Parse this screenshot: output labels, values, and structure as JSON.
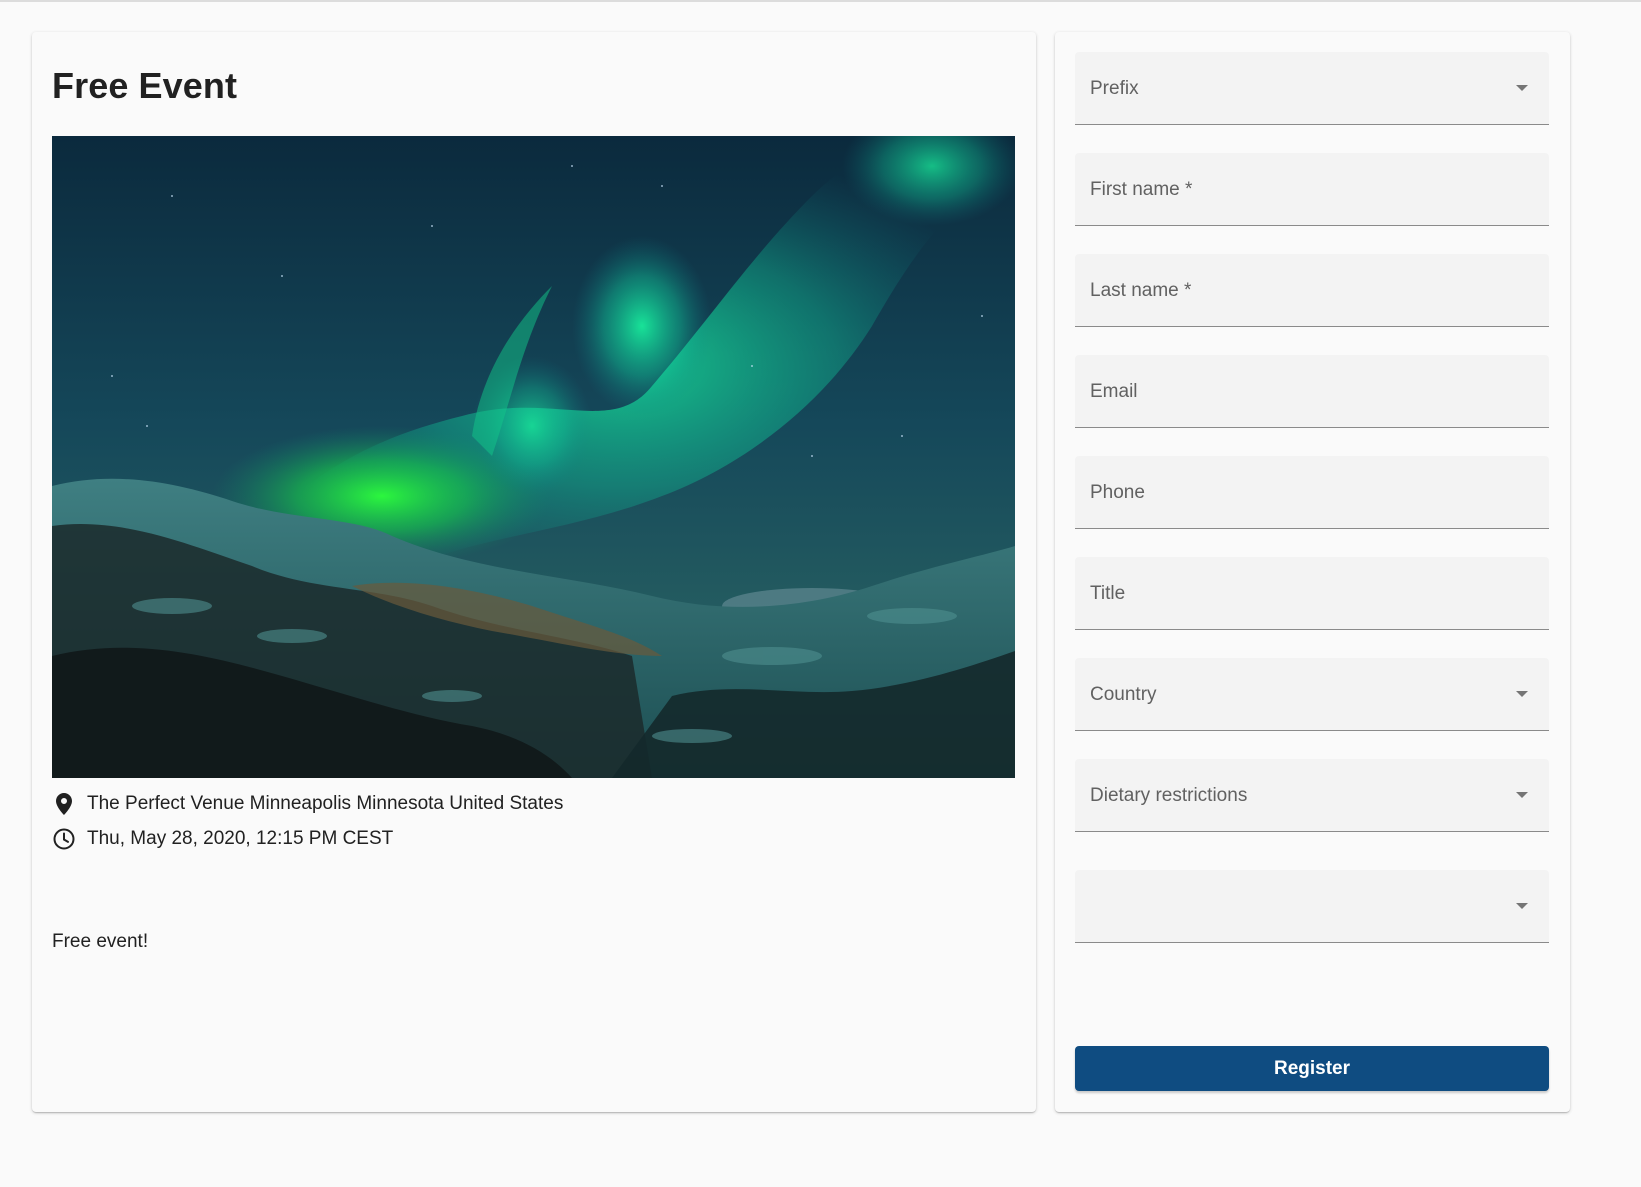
{
  "event": {
    "title": "Free Event",
    "image_alt": "Northern lights over snowy mountains",
    "venue": "The Perfect Venue Minneapolis Minnesota United States",
    "datetime": "Thu, May 28, 2020, 12:15 PM CEST",
    "description": "Free event!",
    "venue_icon": "location-pin-icon",
    "time_icon": "clock-icon"
  },
  "form": {
    "fields": [
      {
        "label": "Prefix",
        "type": "select"
      },
      {
        "label": "First name *",
        "type": "text"
      },
      {
        "label": "Last name *",
        "type": "text"
      },
      {
        "label": "Email",
        "type": "text"
      },
      {
        "label": "Phone",
        "type": "text"
      },
      {
        "label": "Title",
        "type": "text"
      },
      {
        "label": "Country",
        "type": "select"
      },
      {
        "label": "Dietary restrictions",
        "type": "select"
      },
      {
        "label": "",
        "type": "select"
      }
    ],
    "register_label": "Register"
  },
  "colors": {
    "primary": "#0f4c81",
    "background": "#fafafa",
    "field_background": "#f3f3f3"
  }
}
